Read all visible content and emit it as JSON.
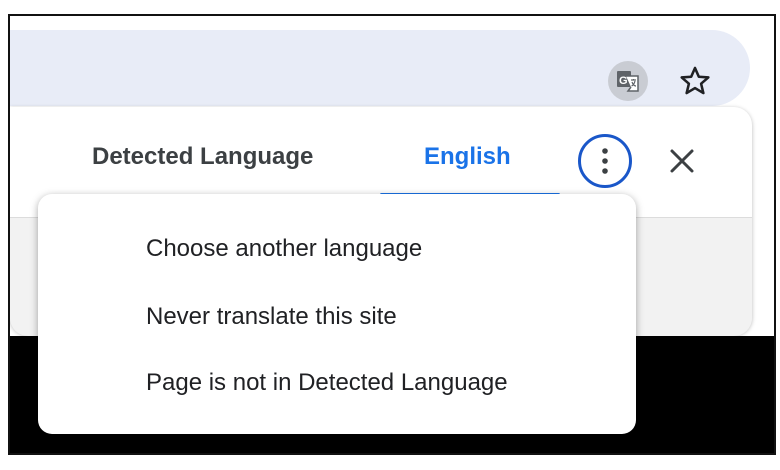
{
  "toolbar": {
    "icons": [
      "translate-icon",
      "star-icon"
    ]
  },
  "translate_panel": {
    "tabs": [
      {
        "label": "Detected Language",
        "selected": false
      },
      {
        "label": "English",
        "selected": true
      }
    ],
    "icons": [
      "more-vert-icon",
      "close-icon"
    ],
    "accent_color": "#1a73e8"
  },
  "menu": {
    "items": [
      {
        "label": "Choose another language"
      },
      {
        "label": "Never translate this site"
      },
      {
        "label": "Page is not in Detected Language"
      }
    ]
  }
}
